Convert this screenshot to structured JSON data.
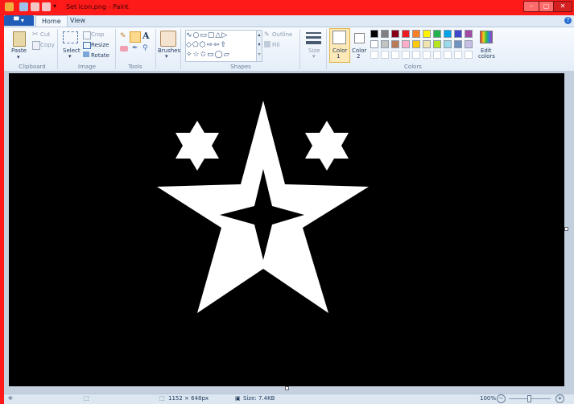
{
  "window": {
    "title": "Set icon.png - Paint",
    "controls": {
      "minimize": "–",
      "maximize": "▢",
      "close": "✕"
    }
  },
  "menu": {
    "file_label": "▀ ▾",
    "tabs": [
      "Home",
      "View"
    ],
    "help_label": "?"
  },
  "ribbon": {
    "clipboard": {
      "label": "Clipboard",
      "paste": "Paste",
      "cut": "Cut",
      "copy": "Copy"
    },
    "image": {
      "label": "Image",
      "select": "Select",
      "crop": "Crop",
      "resize": "Resize",
      "rotate": "Rotate"
    },
    "tools": {
      "label": "Tools"
    },
    "brushes": {
      "label": "Brushes"
    },
    "shapes": {
      "label": "Shapes",
      "outline": "Outline",
      "fill": "Fill"
    },
    "size": {
      "label": "Size"
    },
    "colors": {
      "label": "Colors",
      "color1": "Color",
      "color1_num": "1",
      "color2": "Color",
      "color2_num": "2",
      "edit": "Edit",
      "edit2": "colors",
      "row1": [
        "#000000",
        "#7f7f7f",
        "#880015",
        "#ed1c24",
        "#ff7f27",
        "#fff200",
        "#22b14c",
        "#00a2e8",
        "#3f48cc",
        "#a349a4"
      ],
      "row2": [
        "#ffffff",
        "#c3c3c3",
        "#b97a57",
        "#ffaec9",
        "#ffc90e",
        "#efe4b0",
        "#b5e61d",
        "#99d9ea",
        "#7092be",
        "#c8bfe7"
      ]
    }
  },
  "status": {
    "dimensions": "1152 × 648px",
    "size": "Size: 7.4KB",
    "zoom": "100%",
    "zoom_out": "−",
    "zoom_in": "+"
  }
}
